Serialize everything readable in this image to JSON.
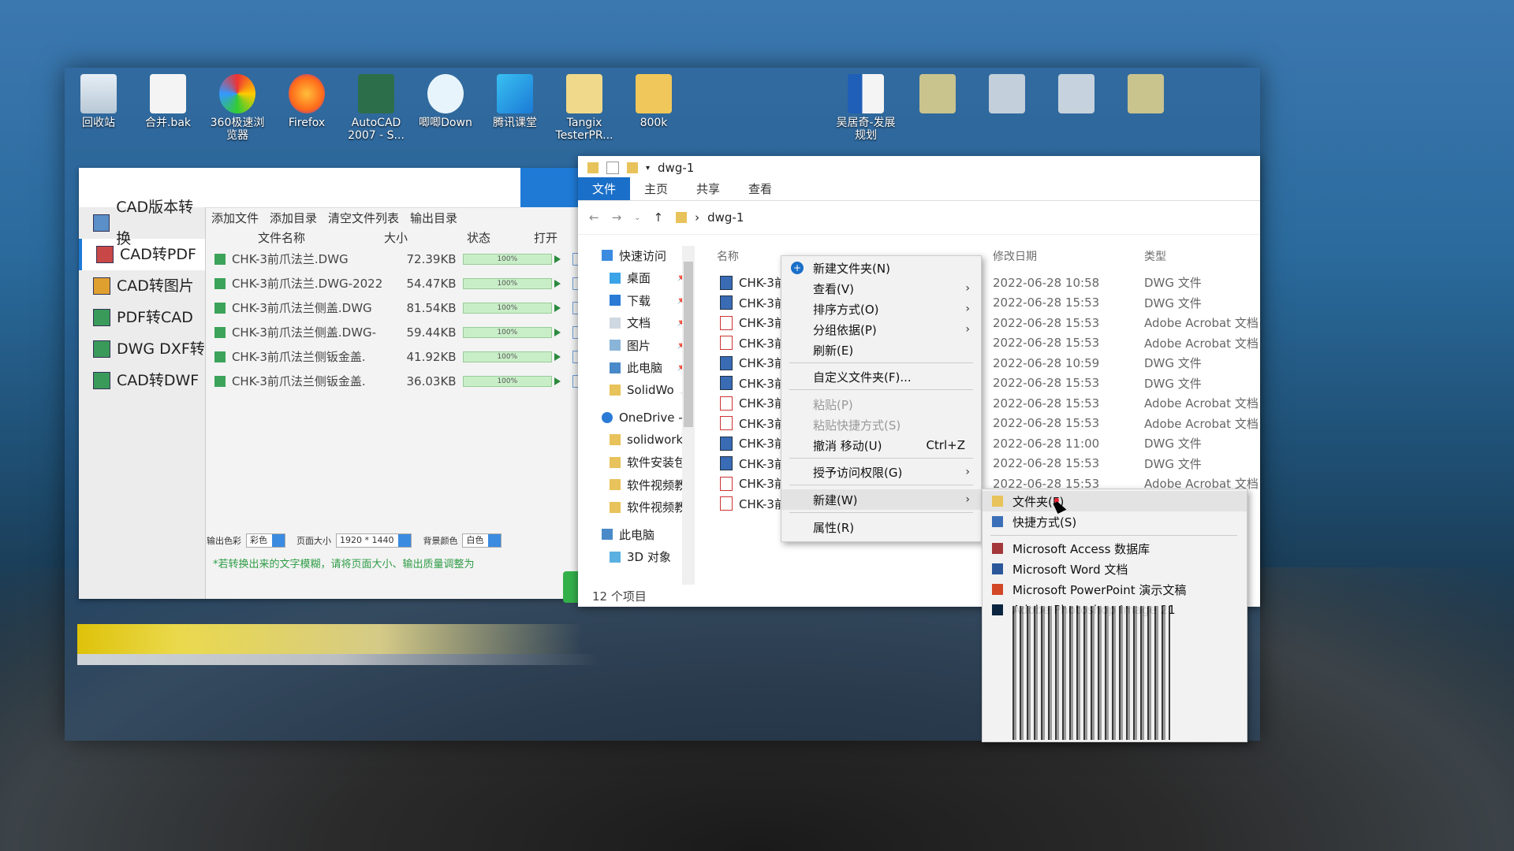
{
  "desktop_icons": [
    {
      "label": "回收站",
      "icon": "recycle-bin-icon"
    },
    {
      "label": "合并.bak",
      "icon": "file-icon"
    },
    {
      "label": "360极速浏览器",
      "icon": "browser-360-icon"
    },
    {
      "label": "Firefox",
      "icon": "firefox-icon"
    },
    {
      "label": "AutoCAD 2007 - S...",
      "icon": "autocad-icon"
    },
    {
      "label": "唧唧Down",
      "icon": "jijidown-icon"
    },
    {
      "label": "腾讯课堂",
      "icon": "tencent-classroom-icon"
    },
    {
      "label": "Tangix TesterPR...",
      "icon": "folder-icon"
    },
    {
      "label": "800k",
      "icon": "folder-icon"
    },
    {
      "label": "吴居奇-发展规划",
      "icon": "word-doc-icon"
    }
  ],
  "cad_app": {
    "sidebar": [
      "CAD版本转换",
      "CAD转PDF",
      "CAD转图片",
      "PDF转CAD",
      "DWG DXF转",
      "CAD转DWF"
    ],
    "active_index": 1,
    "toolbar": {
      "add_file": "添加文件",
      "add_dir": "添加目录",
      "clear": "清空文件列表",
      "output_dir": "输出目录"
    },
    "columns": {
      "name": "文件名称",
      "size": "大小",
      "status": "状态",
      "open": "打开"
    },
    "files": [
      {
        "name": "CHK-3前爪法兰.DWG",
        "size": "72.39KB",
        "progress": "100%"
      },
      {
        "name": "CHK-3前爪法兰.DWG-2022",
        "size": "54.47KB",
        "progress": "100%"
      },
      {
        "name": "CHK-3前爪法兰侧盖.DWG",
        "size": "81.54KB",
        "progress": "100%"
      },
      {
        "name": "CHK-3前爪法兰侧盖.DWG-",
        "size": "59.44KB",
        "progress": "100%"
      },
      {
        "name": "CHK-3前爪法兰侧钣金盖.",
        "size": "41.92KB",
        "progress": "100%"
      },
      {
        "name": "CHK-3前爪法兰侧钣金盖.",
        "size": "36.03KB",
        "progress": "100%"
      }
    ],
    "bottom": {
      "color_label": "输出色彩",
      "color_value": "彩色",
      "page_label": "页面大小",
      "page_value": "1920 * 1440",
      "bg_label": "背景颜色",
      "bg_value": "白色"
    },
    "note": "*若转换出来的文字模糊，请将页面大小、输出质量调整为"
  },
  "explorer": {
    "title": "dwg-1",
    "tabs": [
      "文件",
      "主页",
      "共享",
      "查看"
    ],
    "address": "dwg-1",
    "nav": [
      "快速访问",
      "桌面",
      "下载",
      "文档",
      "图片",
      "此电脑",
      "SolidWo",
      "OneDrive -",
      "solidworks",
      "软件安装包",
      "软件视频教",
      "软件视频教",
      "此电脑",
      "3D 对象"
    ],
    "col_name": "名称",
    "col_date": "修改日期",
    "col_type": "类型",
    "rows": [
      {
        "name": "CHK-3前",
        "date": "2022-06-28 10:58",
        "type": "DWG 文件",
        "kind": "dwg"
      },
      {
        "name": "CHK-3前",
        "date": "2022-06-28 15:53",
        "type": "DWG 文件",
        "kind": "dwg"
      },
      {
        "name": "CHK-3前",
        "date": "2022-06-28 15:53",
        "type": "Adobe Acrobat 文档",
        "kind": "pdf"
      },
      {
        "name": "CHK-3前",
        "date": "2022-06-28 15:53",
        "type": "Adobe Acrobat 文档",
        "kind": "pdf"
      },
      {
        "name": "CHK-3前",
        "date": "2022-06-28 10:59",
        "type": "DWG 文件",
        "kind": "dwg"
      },
      {
        "name": "CHK-3前",
        "date": "2022-06-28 15:53",
        "type": "DWG 文件",
        "kind": "dwg"
      },
      {
        "name": "CHK-3前",
        "date": "2022-06-28 15:53",
        "type": "Adobe Acrobat 文档",
        "kind": "pdf"
      },
      {
        "name": "CHK-3前",
        "date": "2022-06-28 15:53",
        "type": "Adobe Acrobat 文档",
        "kind": "pdf"
      },
      {
        "name": "CHK-3前",
        "date": "2022-06-28 11:00",
        "type": "DWG 文件",
        "kind": "dwg"
      },
      {
        "name": "CHK-3前",
        "date": "2022-06-28 15:53",
        "type": "DWG 文件",
        "kind": "dwg"
      },
      {
        "name": "CHK-3前",
        "date": "2022-06-28 15:53",
        "type": "Adobe Acrobat 文档",
        "kind": "pdf"
      },
      {
        "name": "CHK-3前",
        "date": "",
        "type": "",
        "kind": "pdf"
      }
    ],
    "status": "12 个项目"
  },
  "context_menu": {
    "items": [
      {
        "label": "新建文件夹(N)"
      },
      {
        "label": "查看(V)",
        "arrow": true
      },
      {
        "label": "排序方式(O)",
        "arrow": true
      },
      {
        "label": "分组依据(P)",
        "arrow": true
      },
      {
        "label": "刷新(E)"
      },
      {
        "label": "自定义文件夹(F)..."
      },
      {
        "label": "粘贴(P)",
        "disabled": true
      },
      {
        "label": "粘贴快捷方式(S)",
        "disabled": true
      },
      {
        "label": "撤消 移动(U)",
        "shortcut": "Ctrl+Z"
      },
      {
        "label": "授予访问权限(G)",
        "arrow": true
      },
      {
        "label": "新建(W)",
        "arrow": true
      },
      {
        "label": "属性(R)"
      }
    ]
  },
  "submenu": {
    "items": [
      "文件夹(F)",
      "快捷方式(S)",
      "Microsoft Access 数据库",
      "Microsoft Word 文档",
      "Microsoft PowerPoint 演示文稿",
      "Adobe Photoshop Image 21"
    ]
  }
}
